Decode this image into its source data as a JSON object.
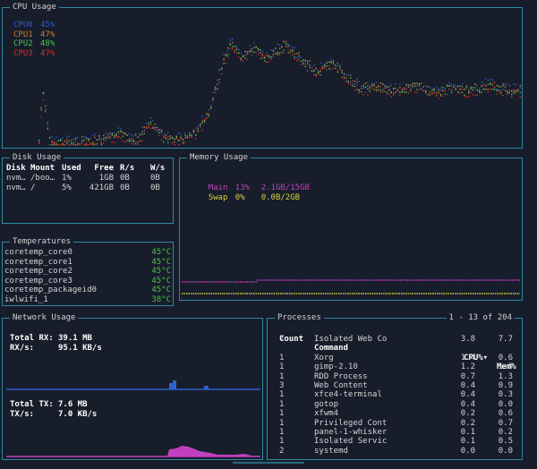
{
  "cpu": {
    "title": "CPU Usage",
    "legend": [
      {
        "name": "CPU0",
        "value": "45%",
        "color": "#2f5fd0"
      },
      {
        "name": "CPU1",
        "value": "47%",
        "color": "#d07a30"
      },
      {
        "name": "CPU2",
        "value": "48%",
        "color": "#4fc04f"
      },
      {
        "name": "CPU3",
        "value": "47%",
        "color": "#d03030"
      }
    ]
  },
  "disk": {
    "title": "Disk Usage",
    "headers": [
      "Disk",
      "Mount",
      "Used",
      "Free",
      "R/s",
      "W/s"
    ],
    "rows": [
      [
        "nvm…",
        "/boo…",
        "1%",
        "1GB",
        "0B",
        "0B"
      ],
      [
        "nvm…",
        "/",
        "5%",
        "421GB",
        "0B",
        "0B"
      ]
    ]
  },
  "memory": {
    "title": "Memory Usage",
    "main": {
      "label": "Main",
      "pct": "13%",
      "value": "2.1GB/15GB",
      "color": "#c040c0"
    },
    "swap": {
      "label": "Swap",
      "pct": "0%",
      "value": "0.0B/2GB",
      "color": "#d8d040"
    }
  },
  "temps": {
    "title": "Temperatures",
    "rows": [
      {
        "name": "coretemp_core0",
        "value": "45°C"
      },
      {
        "name": "coretemp_core1",
        "value": "45°C"
      },
      {
        "name": "coretemp_core2",
        "value": "45°C"
      },
      {
        "name": "coretemp_core3",
        "value": "45°C"
      },
      {
        "name": "coretemp_packageid0",
        "value": "45°C"
      },
      {
        "name": "iwlwifi_1",
        "value": "38°C"
      }
    ]
  },
  "network": {
    "title": "Network Usage",
    "total_rx_label": "Total RX:",
    "total_rx": "39.1 MB",
    "rx_rate_label": "RX/s:",
    "rx_rate": "95.1 KB/s",
    "total_tx_label": "Total TX:",
    "total_tx": "7.6 MB",
    "tx_rate_label": "TX/s:",
    "tx_rate": "7.0 KB/s"
  },
  "processes": {
    "title": "Processes",
    "range": "1 - 13 of 204",
    "headers": {
      "count": "Count",
      "command": "Command",
      "cpu": "CPU%▾",
      "mem": "Mem%"
    },
    "rows": [
      {
        "count": "7",
        "command": "Isolated Web Co",
        "cpu": "3.8",
        "mem": "7.7"
      },
      {
        "count": "",
        "command": "",
        "cpu": "",
        "mem": ""
      },
      {
        "count": "1",
        "command": "Xorg",
        "cpu": "1.4",
        "mem": "0.6"
      },
      {
        "count": "1",
        "command": "gimp-2.10",
        "cpu": "1.2",
        "mem": "1.3"
      },
      {
        "count": "1",
        "command": "RDD Process",
        "cpu": "0.7",
        "mem": "1.3"
      },
      {
        "count": "3",
        "command": "Web Content",
        "cpu": "0.4",
        "mem": "0.9"
      },
      {
        "count": "1",
        "command": "xfce4-terminal",
        "cpu": "0.4",
        "mem": "0.3"
      },
      {
        "count": "1",
        "command": "gotop",
        "cpu": "0.4",
        "mem": "0.0"
      },
      {
        "count": "1",
        "command": "xfwm4",
        "cpu": "0.2",
        "mem": "0.6"
      },
      {
        "count": "1",
        "command": "Privileged Cont",
        "cpu": "0.2",
        "mem": "0.7"
      },
      {
        "count": "1",
        "command": "panel-1-whisker",
        "cpu": "0.1",
        "mem": "0.2"
      },
      {
        "count": "1",
        "command": "Isolated Servic",
        "cpu": "0.1",
        "mem": "0.5"
      },
      {
        "count": "2",
        "command": "systemd",
        "cpu": "0.0",
        "mem": "0.0"
      }
    ]
  }
}
